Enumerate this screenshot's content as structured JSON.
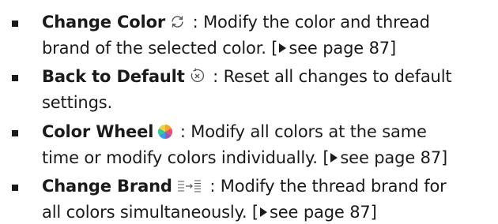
{
  "items": [
    {
      "term": "Change Color",
      "icon": "change-color-refresh-icon",
      "line1_rest": ": Modify the color and thread",
      "line2_pre": "brand of the selected color. [",
      "line2_ref": "see page 87",
      "line2_post": "]"
    },
    {
      "term": "Back to Default",
      "icon": "back-to-default-reset-icon",
      "line1_rest": ": Reset all changes to default",
      "line2": "settings."
    },
    {
      "term": "Color Wheel",
      "icon": "color-wheel-icon",
      "line1_rest": ": Modify all colors at the same",
      "line2_pre": "time or modify colors individually. [",
      "line2_ref": "see page 87",
      "line2_post": "]"
    },
    {
      "term": "Change Brand",
      "icon": "change-brand-icon",
      "line1_rest": ": Modify the thread brand for",
      "line2_pre": "all colors simultaneously. [",
      "line2_ref": "see page 87",
      "line2_post": "]"
    }
  ]
}
